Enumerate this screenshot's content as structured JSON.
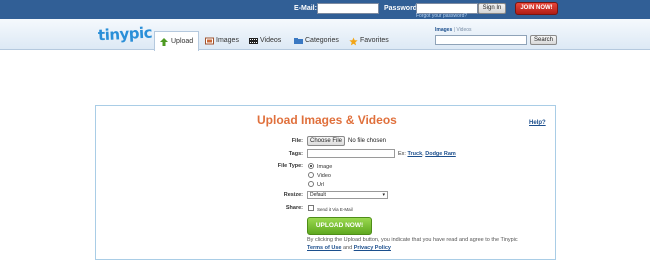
{
  "topbar": {
    "email_label": "E-Mail:",
    "password_label": "Password:",
    "signin_label": "Sign In",
    "join_label": "JOIN NOW!",
    "forgot_label": "Forgot your password?"
  },
  "logo": {
    "text_a": "tiny",
    "text_b": "pic"
  },
  "nav": {
    "tabs": [
      {
        "label": "Upload",
        "icon": "upload-arrow-icon",
        "active": true
      },
      {
        "label": "Images",
        "icon": "images-icon",
        "active": false
      },
      {
        "label": "Videos",
        "icon": "film-icon",
        "active": false
      },
      {
        "label": "Categories",
        "icon": "folder-icon",
        "active": false
      },
      {
        "label": "Favorites",
        "icon": "star-icon",
        "active": false
      }
    ]
  },
  "search": {
    "scope_images": "Images",
    "scope_sep": "|",
    "scope_videos": "Videos",
    "value": "",
    "button_label": "Search"
  },
  "upload": {
    "title": "Upload Images & Videos",
    "help_label": "Help?",
    "file_label": "File:",
    "file_button": "Choose File",
    "file_status": "No file chosen",
    "tags_label": "Tags:",
    "tags_value": "",
    "tags_example_prefix": "Ex:",
    "tags_example_1": "Truck",
    "tags_example_sep": ",",
    "tags_example_2": "Dodge Ram",
    "filetype_label": "File Type:",
    "filetype_options": [
      "Image",
      "Video",
      "Url"
    ],
    "filetype_selected": "Image",
    "resize_label": "Resize:",
    "resize_value": "Default",
    "share_label": "Share:",
    "share_option": "Send it Via E-Mail",
    "submit_label": "UPLOAD NOW!",
    "agree_text": "By clicking the Upload button, you indicate that you have read and agree to the Tinypic",
    "terms_label": "Terms of Use",
    "agree_and": "and",
    "privacy_label": "Privacy Policy"
  },
  "colors": {
    "topbar": "#315f96",
    "title": "#e0703c",
    "join": "#c82a20",
    "upload_button": "#7cc23a",
    "link": "#1c4f8d"
  }
}
